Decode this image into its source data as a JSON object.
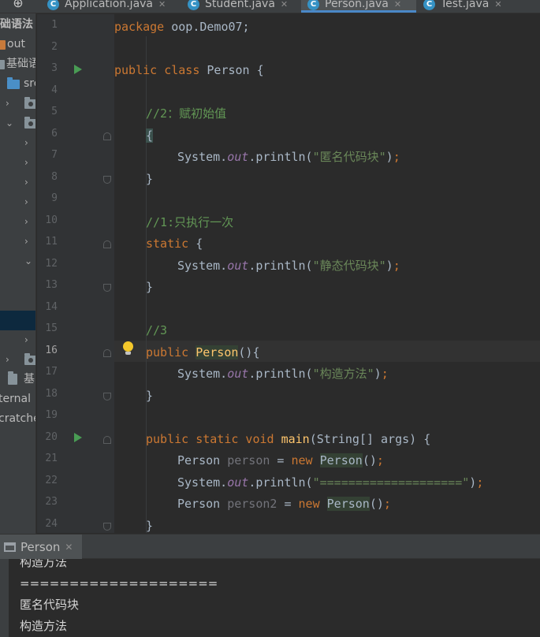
{
  "tabs": [
    {
      "label": "Application.java",
      "icon": "class-icon",
      "icon_letter": "C"
    },
    {
      "label": "Student.java",
      "icon": "class-icon",
      "icon_letter": "C"
    },
    {
      "label": "Person.java",
      "icon": "class-icon",
      "icon_letter": "C",
      "active": true
    },
    {
      "label": "Test.java",
      "icon": "class-icon",
      "icon_letter": "C"
    }
  ],
  "tab_close_glyph": "✕",
  "sidebar": {
    "items": [
      {
        "label": "础语法"
      },
      {
        "label": "out"
      },
      {
        "label": "基础语"
      },
      {
        "label": "src"
      },
      {
        "label": "基"
      },
      {
        "label": "ternal"
      },
      {
        "label": "cratche"
      }
    ]
  },
  "editor": {
    "file": "Person.java",
    "line_numbers": [
      "1",
      "2",
      "3",
      "4",
      "5",
      "6",
      "7",
      "8",
      "9",
      "10",
      "11",
      "12",
      "13",
      "14",
      "15",
      "16",
      "17",
      "18",
      "19",
      "20",
      "21",
      "22",
      "23",
      "24"
    ],
    "current_line": "16",
    "code": {
      "l1_kw": "package",
      "l1_rest": " oop.Demo07;",
      "l3_kw": "public class",
      "l3_rest": " Person {",
      "l5_comment": "//2：赋初始值",
      "l6": "{",
      "l7_a": "System.",
      "l7_out": "out",
      "l7_b": ".println(",
      "l7_str": "\"匿名代码块\"",
      "l7_c": ")",
      "l7_semi": ";",
      "l8": "}",
      "l10_comment": "//1:只执行一次",
      "l11_kw": "static",
      "l11_rest": " {",
      "l12_a": "System.",
      "l12_out": "out",
      "l12_b": ".println(",
      "l12_str": "\"静态代码块\"",
      "l12_c": ")",
      "l12_semi": ";",
      "l13": "}",
      "l15_comment": "//3",
      "l16_kw": "public",
      "l16_name": "Person",
      "l16_rest": "(){",
      "l17_a": "System.",
      "l17_out": "out",
      "l17_b": ".println(",
      "l17_str": "\"构造方法\"",
      "l17_c": ")",
      "l17_semi": ";",
      "l18": "}",
      "l20_kw": "public static void",
      "l20_name": "main",
      "l20_rest": "(String[] args) {",
      "l21_type": "Person ",
      "l21_var": "person",
      "l21_eq": " = ",
      "l21_new": "new",
      "l21_ctor": "Person",
      "l21_end": "()",
      "l21_semi": ";",
      "l22_a": "System.",
      "l22_out": "out",
      "l22_b": ".println(",
      "l22_str": "\"====================\"",
      "l22_c": ")",
      "l22_semi": ";",
      "l23_type": "Person ",
      "l23_var": "person2",
      "l23_eq": " = ",
      "l23_new": "new",
      "l23_ctor": "Person",
      "l23_end": "()",
      "l23_semi": ";",
      "l24": "}"
    }
  },
  "run_panel": {
    "tab_label": "Person",
    "output": [
      "构造方法",
      "====================",
      "匿名代码块",
      "构造方法"
    ]
  },
  "colors": {
    "keyword": "#cc7832",
    "comment": "#629755",
    "string": "#6a8759",
    "field": "#9876aa",
    "method": "#ffc66d",
    "accent": "#4a88c7",
    "run": "#499c54"
  }
}
